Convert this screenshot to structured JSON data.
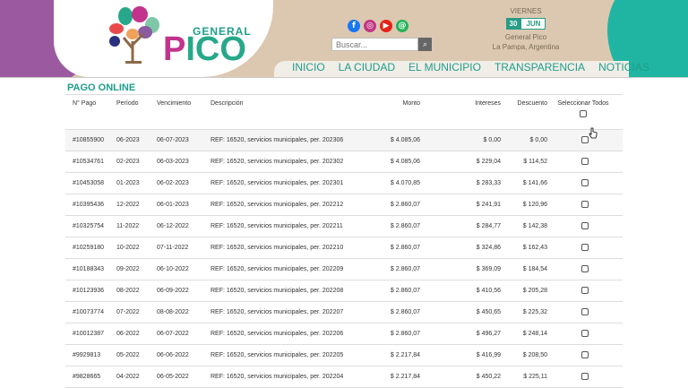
{
  "header": {
    "logo": {
      "top": "GENERAL",
      "bottom": "PICO"
    },
    "social": [
      {
        "icon": "facebook-icon",
        "glyph": "f",
        "color": "#1877f2"
      },
      {
        "icon": "instagram-icon",
        "glyph": "◎",
        "color": "#c13584"
      },
      {
        "icon": "youtube-icon",
        "glyph": "▶",
        "color": "#e62117"
      },
      {
        "icon": "whatsapp-icon",
        "glyph": "@",
        "color": "#25b35a"
      }
    ],
    "search": {
      "placeholder": "Buscar..."
    },
    "date": {
      "weekday": "VIERNES",
      "day": "30",
      "month": "JUN",
      "city": "General Pico",
      "province": "La Pampa, Argentina"
    },
    "nav": [
      "INICIO",
      "LA CIUDAD",
      "EL MUNICIPIO",
      "TRANSPARENCIA",
      "NOTICIAS"
    ]
  },
  "page": {
    "title": "PAGO ONLINE",
    "columns": {
      "num": "N° Pago",
      "periodo": "Período",
      "venc": "Vencimiento",
      "desc": "Descripción",
      "monto": "Monto",
      "intereses": "Intereses",
      "descuento": "Descuento",
      "select_all": "Seleccionar Todos"
    },
    "rows": [
      {
        "num": "#10855900",
        "periodo": "06-2023",
        "venc": "06-07-2023",
        "desc": "REF: 16520, servicios municipales, per. 202306",
        "monto": "$ 4.085,06",
        "intereses": "$ 0,00",
        "descuento": "$ 0,00"
      },
      {
        "num": "#10534761",
        "periodo": "02-2023",
        "venc": "06-03-2023",
        "desc": "REF: 16520, servicios municipales, per. 202302",
        "monto": "$ 4.085,06",
        "intereses": "$ 229,04",
        "descuento": "$ 114,52"
      },
      {
        "num": "#10453058",
        "periodo": "01-2023",
        "venc": "06-02-2023",
        "desc": "REF: 16520, servicios municipales, per. 202301",
        "monto": "$ 4.070,85",
        "intereses": "$ 283,33",
        "descuento": "$ 141,66"
      },
      {
        "num": "#10395436",
        "periodo": "12-2022",
        "venc": "06-01-2023",
        "desc": "REF: 16520, servicios municipales, per. 202212",
        "monto": "$ 2.860,07",
        "intereses": "$ 241,91",
        "descuento": "$ 120,96"
      },
      {
        "num": "#10325754",
        "periodo": "11-2022",
        "venc": "06-12-2022",
        "desc": "REF: 16520, servicios municipales, per. 202211",
        "monto": "$ 2.860,07",
        "intereses": "$ 284,77",
        "descuento": "$ 142,38"
      },
      {
        "num": "#10259180",
        "periodo": "10-2022",
        "venc": "07-11-2022",
        "desc": "REF: 16520, servicios municipales, per. 202210",
        "monto": "$ 2.860,07",
        "intereses": "$ 324,86",
        "descuento": "$ 162,43"
      },
      {
        "num": "#10188343",
        "periodo": "09-2022",
        "venc": "06-10-2022",
        "desc": "REF: 16520, servicios municipales, per. 202209",
        "monto": "$ 2.860,07",
        "intereses": "$ 369,09",
        "descuento": "$ 184,54"
      },
      {
        "num": "#10123936",
        "periodo": "08-2022",
        "venc": "06-09-2022",
        "desc": "REF: 16520, servicios municipales, per. 202208",
        "monto": "$ 2.860,07",
        "intereses": "$ 410,56",
        "descuento": "$ 205,28"
      },
      {
        "num": "#10073774",
        "periodo": "07-2022",
        "venc": "08-08-2022",
        "desc": "REF: 16520, servicios municipales, per. 202207",
        "monto": "$ 2.860,07",
        "intereses": "$ 450,65",
        "descuento": "$ 225,32"
      },
      {
        "num": "#10012387",
        "periodo": "06-2022",
        "venc": "06-07-2022",
        "desc": "REF: 16520, servicios municipales, per. 202206",
        "monto": "$ 2.860,07",
        "intereses": "$ 496,27",
        "descuento": "$ 248,14"
      },
      {
        "num": "#9929813",
        "periodo": "05-2022",
        "venc": "06-06-2022",
        "desc": "REF: 16520, servicios municipales, per. 202205",
        "monto": "$ 2.217,84",
        "intereses": "$ 416,99",
        "descuento": "$ 208,50"
      },
      {
        "num": "#9828665",
        "periodo": "04-2022",
        "venc": "06-05-2022",
        "desc": "REF: 16520, servicios municipales, per. 202204",
        "monto": "$ 2.217,84",
        "intereses": "$ 450,22",
        "descuento": "$ 225,11"
      }
    ]
  },
  "colors": {
    "accent": "#1f9e8a",
    "purple": "#9b5aa0",
    "teal": "#1fb5a2",
    "beige": "#dcc8b0",
    "brand_pink": "#c2338c"
  }
}
